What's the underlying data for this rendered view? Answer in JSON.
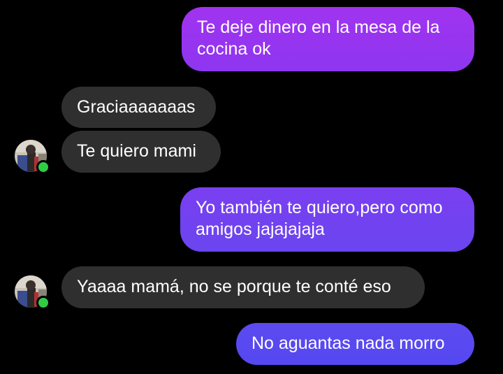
{
  "colors": {
    "background": "#000000",
    "incoming_bubble": "#2f2f2f",
    "outgoing_gradient_top": "#a033f0",
    "outgoing_gradient_bottom": "#5a4bf0",
    "online_indicator": "#31cc46",
    "text": "#ffffff"
  },
  "contact": {
    "avatar_icon": "profile-photo",
    "online_icon": "online-status-dot"
  },
  "messages": [
    {
      "direction": "outgoing",
      "lines": [
        "Te deje dinero en la mesa de la",
        "cocina ok"
      ]
    },
    {
      "direction": "incoming",
      "lines": [
        "Graciaaaaaaas"
      ]
    },
    {
      "direction": "incoming",
      "lines": [
        "Te quiero mami"
      ]
    },
    {
      "direction": "outgoing",
      "lines": [
        "Yo también te quiero,pero como",
        "amigos jajajajaja"
      ]
    },
    {
      "direction": "incoming",
      "lines": [
        "Yaaaa mamá, no se porque te conté eso"
      ]
    },
    {
      "direction": "outgoing",
      "lines": [
        "No aguantas nada morro"
      ]
    }
  ]
}
